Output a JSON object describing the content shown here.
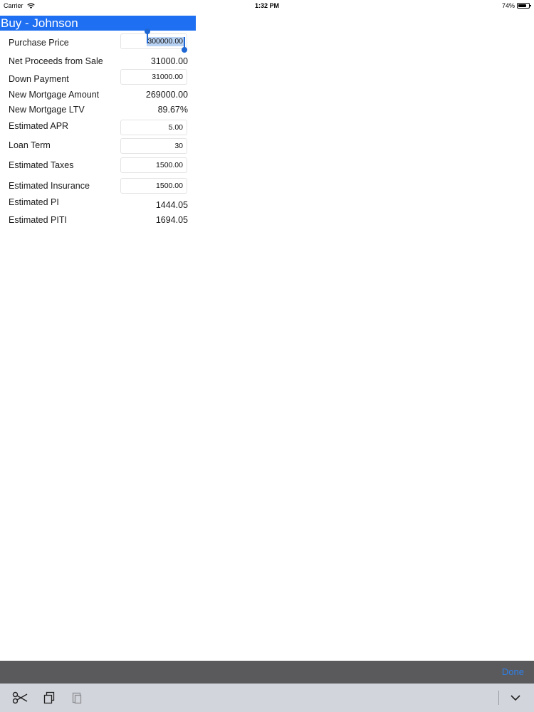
{
  "status_bar": {
    "carrier": "Carrier",
    "time": "1:32 PM",
    "battery": "74%"
  },
  "page_title": "Buy - Johnson",
  "fields": {
    "purchase_price": {
      "label": "Purchase Price",
      "value": "300000.00"
    },
    "net_proceeds": {
      "label": "Net Proceeds from Sale",
      "value": "31000.00"
    },
    "down_payment": {
      "label": "Down Payment",
      "value": "31000.00"
    },
    "new_mortgage_amount": {
      "label": "New Mortgage Amount",
      "value": "269000.00"
    },
    "new_mortgage_ltv": {
      "label": "New Mortgage LTV",
      "value": "89.67%"
    },
    "estimated_apr": {
      "label": "Estimated APR",
      "value": "5.00"
    },
    "loan_term": {
      "label": "Loan Term",
      "value": "30"
    },
    "estimated_taxes": {
      "label": "Estimated Taxes",
      "value": "1500.00"
    },
    "estimated_insurance": {
      "label": "Estimated Insurance",
      "value": "1500.00"
    },
    "estimated_pi": {
      "label": "Estimated PI",
      "value": "1444.05"
    },
    "estimated_piti": {
      "label": "Estimated PITI",
      "value": "1694.05"
    }
  },
  "keyboard": {
    "done_label": "Done",
    "shortcuts": [
      "scissors-icon",
      "copy-icon",
      "paste-icon",
      "chevron-down-icon"
    ]
  },
  "colors": {
    "title_bar": "#1e6ff2",
    "selection": "#b8d2f4",
    "accessory_bar": "#5a5a5c",
    "shortcut_bar": "#d2d5db"
  }
}
